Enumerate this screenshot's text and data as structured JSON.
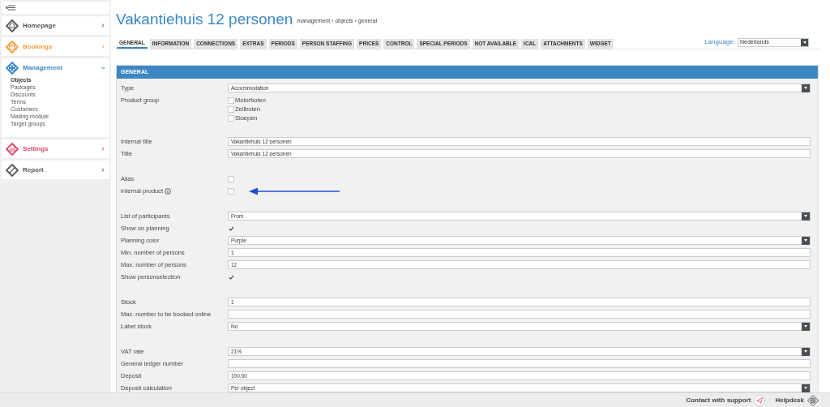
{
  "sidebar": {
    "items": [
      {
        "label": "Homepage",
        "color": "#555555",
        "expanded": false
      },
      {
        "label": "Bookings",
        "color": "#f2a03d",
        "expanded": false
      },
      {
        "label": "Management",
        "color": "#3a87c7",
        "expanded": true,
        "children": [
          {
            "label": "Objects",
            "selected": true
          },
          {
            "label": "Packages",
            "selected": false
          },
          {
            "label": "Discounts",
            "selected": false
          },
          {
            "label": "Terms",
            "selected": false
          },
          {
            "label": "Customers",
            "selected": false
          },
          {
            "label": "Mailing module",
            "selected": false
          },
          {
            "label": "Target groups",
            "selected": false
          }
        ]
      },
      {
        "label": "Settings",
        "color": "#e0456b",
        "expanded": false
      },
      {
        "label": "Report",
        "color": "#555555",
        "expanded": false
      }
    ]
  },
  "page": {
    "title": "Vakantiehuis 12 personen",
    "breadcrumb": "management › objects › general"
  },
  "tabs": [
    {
      "label": "GENERAL",
      "selected": true
    },
    {
      "label": "INFORMATION",
      "selected": false
    },
    {
      "label": "CONNECTIONS",
      "selected": false
    },
    {
      "label": "EXTRAS",
      "selected": false
    },
    {
      "label": "PERIODS",
      "selected": false
    },
    {
      "label": "PERSON STAFFING",
      "selected": false
    },
    {
      "label": "PRICES",
      "selected": false
    },
    {
      "label": "CONTROL",
      "selected": false
    },
    {
      "label": "SPECIAL PERIODS",
      "selected": false
    },
    {
      "label": "NOT AVAILABLE",
      "selected": false
    },
    {
      "label": "ICAL",
      "selected": false
    },
    {
      "label": "ATTACHMENTS",
      "selected": false
    },
    {
      "label": "WIDGET",
      "selected": false
    }
  ],
  "language": {
    "label": "Language:",
    "value": "Nederlands"
  },
  "panel": {
    "title": "GENERAL",
    "groups": [
      [
        {
          "label": "Type",
          "kind": "select",
          "value": "Accommodation"
        },
        {
          "label": "Product group",
          "kind": "checkgroup",
          "options": [
            {
              "label": "Motorboten",
              "checked": false
            },
            {
              "label": "Zeilboten",
              "checked": false
            },
            {
              "label": "Sloepen",
              "checked": false
            }
          ]
        }
      ],
      [
        {
          "label": "Internal title",
          "kind": "text",
          "value": "Vakantiehuis 12 personen"
        },
        {
          "label": "Title",
          "kind": "text",
          "value": "Vakantiehuis 12 personen"
        }
      ],
      [
        {
          "label": "Alias",
          "kind": "checkbox",
          "checked": false
        },
        {
          "label": "Internal product",
          "kind": "checkbox",
          "checked": false,
          "info": true,
          "highlighted": true
        }
      ],
      [
        {
          "label": "List of participants",
          "kind": "select",
          "value": "From"
        },
        {
          "label": "Show on planning",
          "kind": "checkbox",
          "checked": true
        },
        {
          "label": "Planning color",
          "kind": "select",
          "value": "Purple"
        },
        {
          "label": "Min. number of persons",
          "kind": "text",
          "value": "1"
        },
        {
          "label": "Max. number of persons",
          "kind": "text",
          "value": "12"
        },
        {
          "label": "Show personselection",
          "kind": "checkbox",
          "checked": true
        }
      ],
      [
        {
          "label": "Stock",
          "kind": "text",
          "value": "1"
        },
        {
          "label": "Max. number to be booked online",
          "kind": "text"
        },
        {
          "label": "Label stock",
          "kind": "select",
          "value": "No"
        }
      ],
      [
        {
          "label": "VAT rate",
          "kind": "select",
          "value": "21%"
        },
        {
          "label": "General ledger number",
          "kind": "text"
        },
        {
          "label": "Deposit",
          "kind": "text",
          "value": "100.00"
        },
        {
          "label": "Deposit calculation",
          "kind": "select",
          "value": "Per object"
        }
      ]
    ]
  },
  "footer": {
    "support": "Contact with support",
    "helpdesk": "Helpdesk"
  }
}
